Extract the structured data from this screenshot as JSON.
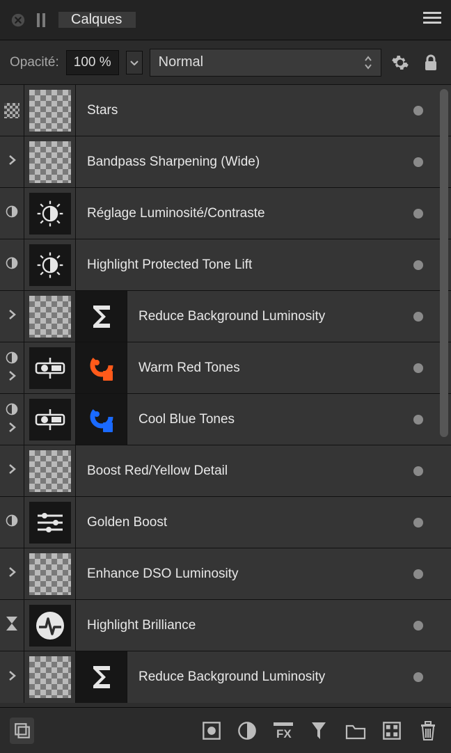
{
  "tab_title": "Calques",
  "toolbar": {
    "opacity_label": "Opacité:",
    "opacity_value": "100 %",
    "blend_mode": "Normal"
  },
  "layers": [
    {
      "name": "Stars",
      "thumb": "checker",
      "col0": [
        "checker"
      ],
      "extras": []
    },
    {
      "name": "Bandpass Sharpening (Wide)",
      "thumb": "checker",
      "col0": [
        "chev"
      ],
      "extras": []
    },
    {
      "name": "Réglage Luminosité/Contraste",
      "thumb": "sun",
      "col0": [
        "half"
      ],
      "extras": []
    },
    {
      "name": "Highlight Protected Tone Lift",
      "thumb": "sun",
      "col0": [
        "half"
      ],
      "extras": []
    },
    {
      "name": "Reduce Background Luminosity",
      "thumb": "checker",
      "col0": [
        "chev"
      ],
      "extras": [
        "sigma"
      ]
    },
    {
      "name": "Warm Red Tones",
      "thumb": "recolor",
      "col0": [
        "half",
        "chev"
      ],
      "extras": [
        "recolor-red"
      ]
    },
    {
      "name": "Cool Blue Tones",
      "thumb": "recolor",
      "col0": [
        "half",
        "chev"
      ],
      "extras": [
        "recolor-blue"
      ]
    },
    {
      "name": "Boost Red/Yellow Detail",
      "thumb": "checker",
      "col0": [
        "chev"
      ],
      "extras": []
    },
    {
      "name": "Golden Boost",
      "thumb": "sliders",
      "col0": [
        "half"
      ],
      "extras": []
    },
    {
      "name": "Enhance DSO Luminosity",
      "thumb": "checker",
      "col0": [
        "chev"
      ],
      "extras": []
    },
    {
      "name": "Highlight Brilliance",
      "thumb": "pulse",
      "col0": [
        "hourglass"
      ],
      "extras": []
    },
    {
      "name": "Reduce Background Luminosity",
      "thumb": "checker",
      "col0": [
        "chev"
      ],
      "extras": [
        "sigma"
      ]
    }
  ]
}
